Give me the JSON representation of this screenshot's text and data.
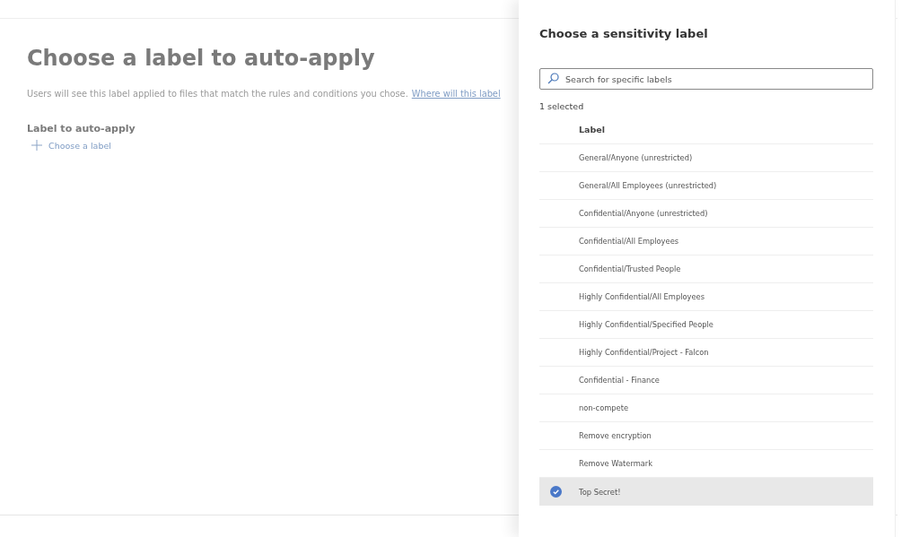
{
  "page": {
    "title": "Choose a label to auto-apply",
    "description": "Users will see this label applied to files that match the rules and conditions you chose.",
    "link": "Where will this label",
    "section_label": "Label to auto-apply",
    "add_button": "Choose a label"
  },
  "panel": {
    "title": "Choose a sensitivity label",
    "search": {
      "placeholder": "Search for specific labels"
    },
    "selected_count": "1 selected",
    "column": "Label",
    "rows": [
      {
        "label": "General/Anyone (unrestricted)",
        "selected": false
      },
      {
        "label": "General/All Employees (unrestricted)",
        "selected": false
      },
      {
        "label": "Confidential/Anyone (unrestricted)",
        "selected": false
      },
      {
        "label": "Confidential/All Employees",
        "selected": false
      },
      {
        "label": "Confidential/Trusted People",
        "selected": false
      },
      {
        "label": "Highly Confidential/All Employees",
        "selected": false
      },
      {
        "label": "Highly Confidential/Specified People",
        "selected": false
      },
      {
        "label": "Highly Confidential/Project - Falcon",
        "selected": false
      },
      {
        "label": "Confidential - Finance",
        "selected": false
      },
      {
        "label": "non-compete",
        "selected": false
      },
      {
        "label": "Remove encryption",
        "selected": false
      },
      {
        "label": "Remove Watermark",
        "selected": false
      },
      {
        "label": "Top Secret!",
        "selected": true
      }
    ]
  }
}
